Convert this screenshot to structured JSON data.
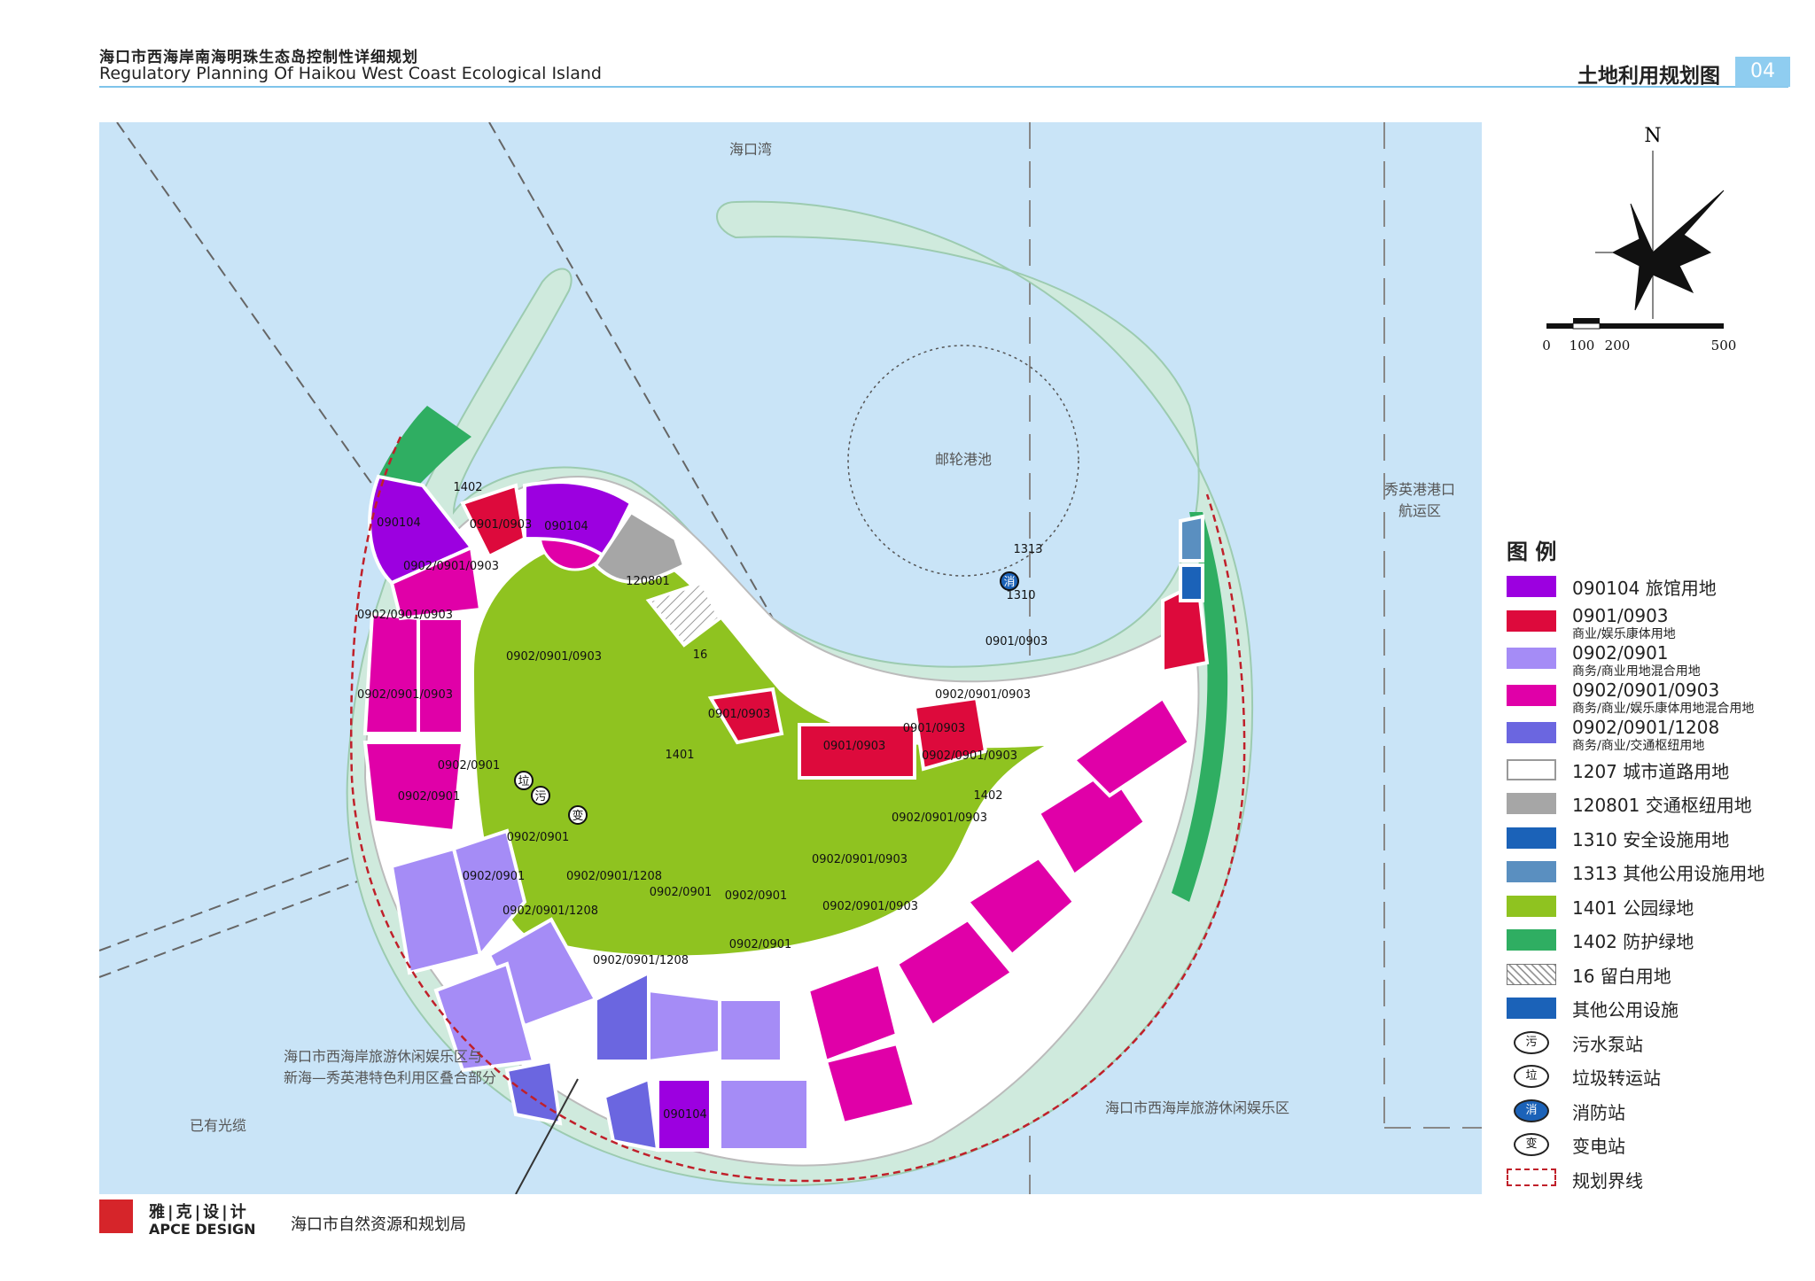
{
  "header": {
    "title_cn": "海口市西海岸南海明珠生态岛控制性详细规划",
    "title_en": "Regulatory Planning Of Haikou West Coast Ecological Island",
    "sheet_title": "土地利用规划图",
    "sheet_number": "04"
  },
  "colors": {
    "water": "#c9e4f7",
    "island_edge": "#cfeadd",
    "hotel": "#9c00e0",
    "commercial": "#dd0a3c",
    "business_mixed": "#a58cf6",
    "business_entertain": "#e000a8",
    "business_transport": "#6b66e0",
    "transport_hub": "#a6a6a6",
    "park": "#8fc320",
    "protect_green": "#2fae62",
    "safety": "#1b62b8",
    "boundary": "#c0202a"
  },
  "map": {
    "labels": {
      "bay": "海口湾",
      "cruise_basin": "邮轮港池",
      "xiuying_port": "秀英港港口",
      "xiuying_nav": "航运区",
      "overlap_1": "海口市西海岸旅游休闲娱乐区与",
      "overlap_2": "新海—秀英港特色利用区叠合部分",
      "cable": "已有光缆",
      "west_coast": "海口市西海岸旅游休闲娱乐区"
    },
    "parcels": {
      "hotel_nw": "090104",
      "hotel_n": "090104",
      "hotel_s": "090104",
      "comm_n": "0901/0903",
      "comm_e1": "0901/0903",
      "comm_e2": "0901/0903",
      "comm_e3": "0901/0903",
      "comm_e4": "0901/0903",
      "mix_1": "0902/0901/0903",
      "mix_2": "0902/0901/0903",
      "mix_3": "0902/0901/0903",
      "mix_center": "0902/0901/0903",
      "mix_e1": "0902/0901/0903",
      "mix_e2": "0902/0901/0903",
      "mix_e3": "0902/0901/0903",
      "mix_s1": "0902/0901/0903",
      "mix_s2": "0902/0901/0903",
      "biz_1": "0902/0901",
      "biz_2": "0902/0901",
      "biz_3": "0902/0901",
      "biz_4": "0902/0901",
      "biz_5": "0902/0901",
      "biz_6": "0902/0901",
      "biz_7": "0902/0901",
      "tr_1": "0902/0901/1208",
      "tr_2": "0902/0901/1208",
      "tr_3": "0902/0901/1208",
      "hub": "120801",
      "reserve": "16",
      "park": "1401",
      "green_n": "1402",
      "green_e": "1402",
      "p1313": "1313",
      "p1310": "1310"
    },
    "facility_marks": {
      "garbage": "垃",
      "sewage": "污",
      "power": "变",
      "fire": "消"
    }
  },
  "north_arrow": {
    "letter": "N",
    "scale_ticks": [
      "0",
      "100",
      "200",
      "500"
    ]
  },
  "legend": {
    "title": "图 例",
    "items": [
      {
        "code": "090104 旅馆用地",
        "sub": "",
        "color": "#9c00e0",
        "kind": "fill"
      },
      {
        "code": "0901/0903",
        "sub": "商业/娱乐康体用地",
        "color": "#dd0a3c",
        "kind": "fill"
      },
      {
        "code": "0902/0901",
        "sub": "商务/商业用地混合用地",
        "color": "#a58cf6",
        "kind": "fill"
      },
      {
        "code": "0902/0901/0903",
        "sub": "商务/商业/娱乐康体用地混合用地",
        "color": "#e000a8",
        "kind": "fill"
      },
      {
        "code": "0902/0901/1208",
        "sub": "商务/商业/交通枢纽用地",
        "color": "#6b66e0",
        "kind": "fill"
      },
      {
        "code": "1207 城市道路用地",
        "sub": "",
        "color": "#ffffff",
        "kind": "road"
      },
      {
        "code": "120801 交通枢纽用地",
        "sub": "",
        "color": "#a6a6a6",
        "kind": "fill"
      },
      {
        "code": "1310 安全设施用地",
        "sub": "",
        "color": "#1b62b8",
        "kind": "fill"
      },
      {
        "code": "1313 其他公用设施用地",
        "sub": "",
        "color": "#5a8fc0",
        "kind": "fill"
      },
      {
        "code": "1401 公园绿地",
        "sub": "",
        "color": "#8fc320",
        "kind": "fill"
      },
      {
        "code": "1402 防护绿地",
        "sub": "",
        "color": "#2fae62",
        "kind": "fill"
      },
      {
        "code": "16 留白用地",
        "sub": "",
        "color": "#ffffff",
        "kind": "hatch"
      },
      {
        "code": "其他公用设施",
        "sub": "",
        "color": "#1b62b8",
        "kind": "fill"
      },
      {
        "code": "污水泵站",
        "sub": "",
        "color": "#ffffff",
        "kind": "icon",
        "glyph": "污"
      },
      {
        "code": "垃圾转运站",
        "sub": "",
        "color": "#ffffff",
        "kind": "icon",
        "glyph": "垃"
      },
      {
        "code": "消防站",
        "sub": "",
        "color": "#1b62b8",
        "kind": "icon",
        "glyph": "消"
      },
      {
        "code": "变电站",
        "sub": "",
        "color": "#ffffff",
        "kind": "icon",
        "glyph": "变"
      },
      {
        "code": "规划界线",
        "sub": "",
        "color": "#c0202a",
        "kind": "dash"
      }
    ]
  },
  "footer": {
    "brand_cn": "雅|克|设|计",
    "brand_en": "APCE DESIGN",
    "agency": "海口市自然资源和规划局"
  }
}
